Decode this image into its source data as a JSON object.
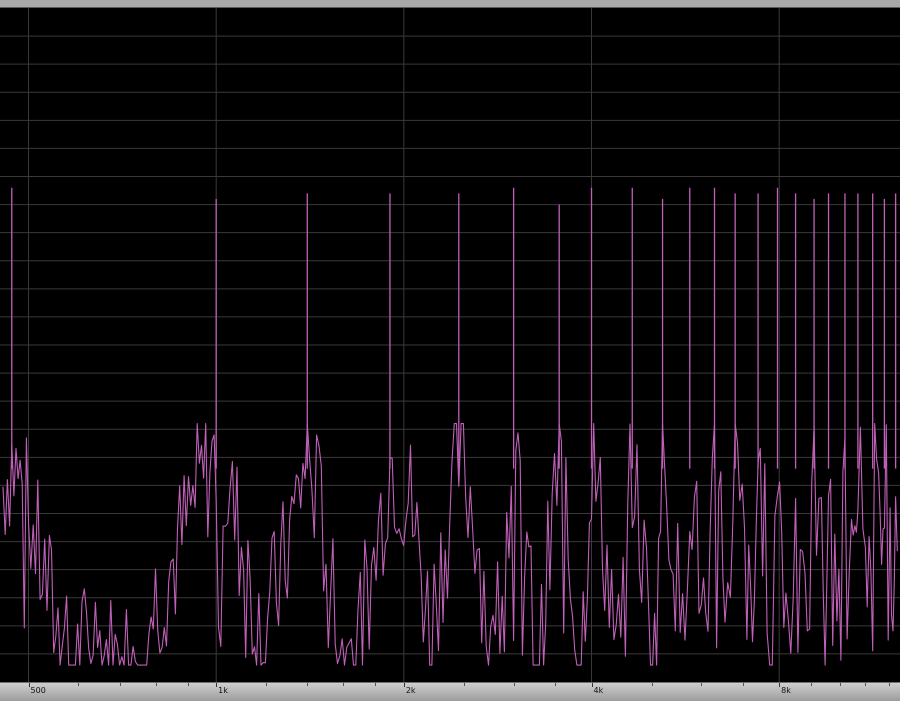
{
  "chart_data": {
    "type": "line",
    "title": "",
    "xlabel": "",
    "ylabel": "",
    "x_scale": "log",
    "xlim": [
      450,
      12500
    ],
    "ylim": [
      -120,
      0
    ],
    "grid": true,
    "x_ticks": [
      {
        "value": 500,
        "label": "500"
      },
      {
        "value": 1000,
        "label": "1k"
      },
      {
        "value": 2000,
        "label": "2k"
      },
      {
        "value": 4000,
        "label": "4k"
      },
      {
        "value": 8000,
        "label": "8k"
      }
    ],
    "colors": {
      "trace": "#c060b8",
      "grid": "#3a3a3a",
      "background": "#000000"
    },
    "series": [
      {
        "kind": "harmonic-peaks",
        "peaks": [
          {
            "x": 470,
            "y": -32
          },
          {
            "x": 1000,
            "y": -34
          },
          {
            "x": 1400,
            "y": -33
          },
          {
            "x": 1900,
            "y": -33
          },
          {
            "x": 2450,
            "y": -33
          },
          {
            "x": 3000,
            "y": -32
          },
          {
            "x": 3550,
            "y": -35
          },
          {
            "x": 4000,
            "y": -32
          },
          {
            "x": 4650,
            "y": -32
          },
          {
            "x": 5200,
            "y": -34
          },
          {
            "x": 5750,
            "y": -32
          },
          {
            "x": 6300,
            "y": -32
          },
          {
            "x": 6800,
            "y": -33
          },
          {
            "x": 7400,
            "y": -33
          },
          {
            "x": 7950,
            "y": -32
          },
          {
            "x": 8500,
            "y": -33
          },
          {
            "x": 9100,
            "y": -34
          },
          {
            "x": 9600,
            "y": -33
          },
          {
            "x": 10200,
            "y": -33
          },
          {
            "x": 10700,
            "y": -33
          },
          {
            "x": 11300,
            "y": -33
          },
          {
            "x": 11800,
            "y": -34
          },
          {
            "x": 12300,
            "y": -33
          }
        ]
      },
      {
        "kind": "noise-floor",
        "points": [
          {
            "x": 455,
            "y": -85
          },
          {
            "x": 470,
            "y": -80
          },
          {
            "x": 500,
            "y": -90
          },
          {
            "x": 540,
            "y": -105
          },
          {
            "x": 580,
            "y": -118
          },
          {
            "x": 640,
            "y": -112
          },
          {
            "x": 700,
            "y": -118
          },
          {
            "x": 780,
            "y": -108
          },
          {
            "x": 860,
            "y": -98
          },
          {
            "x": 940,
            "y": -85
          },
          {
            "x": 1000,
            "y": -80
          },
          {
            "x": 1080,
            "y": -92
          },
          {
            "x": 1180,
            "y": -112
          },
          {
            "x": 1280,
            "y": -100
          },
          {
            "x": 1400,
            "y": -79
          },
          {
            "x": 1500,
            "y": -95
          },
          {
            "x": 1620,
            "y": -118
          },
          {
            "x": 1760,
            "y": -105
          },
          {
            "x": 1900,
            "y": -80
          },
          {
            "x": 2050,
            "y": -88
          },
          {
            "x": 2200,
            "y": -110
          },
          {
            "x": 2330,
            "y": -95
          },
          {
            "x": 2450,
            "y": -80
          },
          {
            "x": 2600,
            "y": -90
          },
          {
            "x": 2780,
            "y": -117
          },
          {
            "x": 2900,
            "y": -95
          },
          {
            "x": 3000,
            "y": -81
          },
          {
            "x": 3150,
            "y": -100
          },
          {
            "x": 3300,
            "y": -118
          },
          {
            "x": 3430,
            "y": -96
          },
          {
            "x": 3550,
            "y": -79
          },
          {
            "x": 3700,
            "y": -102
          },
          {
            "x": 3850,
            "y": -116
          },
          {
            "x": 4000,
            "y": -80
          },
          {
            "x": 4200,
            "y": -96
          },
          {
            "x": 4420,
            "y": -115
          },
          {
            "x": 4650,
            "y": -81
          },
          {
            "x": 4900,
            "y": -104
          },
          {
            "x": 5050,
            "y": -116
          },
          {
            "x": 5200,
            "y": -79
          },
          {
            "x": 5450,
            "y": -98
          },
          {
            "x": 5600,
            "y": -114
          },
          {
            "x": 5750,
            "y": -82
          },
          {
            "x": 6000,
            "y": -104
          },
          {
            "x": 6150,
            "y": -117
          },
          {
            "x": 6300,
            "y": -80
          },
          {
            "x": 6550,
            "y": -100
          },
          {
            "x": 6680,
            "y": -112
          },
          {
            "x": 6800,
            "y": -81
          },
          {
            "x": 7100,
            "y": -102
          },
          {
            "x": 7250,
            "y": -116
          },
          {
            "x": 7400,
            "y": -80
          },
          {
            "x": 7650,
            "y": -98
          },
          {
            "x": 7800,
            "y": -112
          },
          {
            "x": 7950,
            "y": -82
          },
          {
            "x": 8200,
            "y": -104
          },
          {
            "x": 8350,
            "y": -116
          },
          {
            "x": 8500,
            "y": -81
          },
          {
            "x": 8800,
            "y": -100
          },
          {
            "x": 8950,
            "y": -110
          },
          {
            "x": 9100,
            "y": -80
          },
          {
            "x": 9350,
            "y": -98
          },
          {
            "x": 9480,
            "y": -112
          },
          {
            "x": 9600,
            "y": -79
          },
          {
            "x": 9900,
            "y": -100
          },
          {
            "x": 10050,
            "y": -108
          },
          {
            "x": 10200,
            "y": -80
          },
          {
            "x": 10450,
            "y": -96
          },
          {
            "x": 10580,
            "y": -104
          },
          {
            "x": 10700,
            "y": -79
          },
          {
            "x": 11000,
            "y": -95
          },
          {
            "x": 11150,
            "y": -104
          },
          {
            "x": 11300,
            "y": -78
          },
          {
            "x": 11550,
            "y": -94
          },
          {
            "x": 11680,
            "y": -106
          },
          {
            "x": 11800,
            "y": -80
          },
          {
            "x": 12050,
            "y": -96
          },
          {
            "x": 12180,
            "y": -104
          },
          {
            "x": 12300,
            "y": -78
          },
          {
            "x": 12450,
            "y": -90
          }
        ]
      }
    ]
  }
}
